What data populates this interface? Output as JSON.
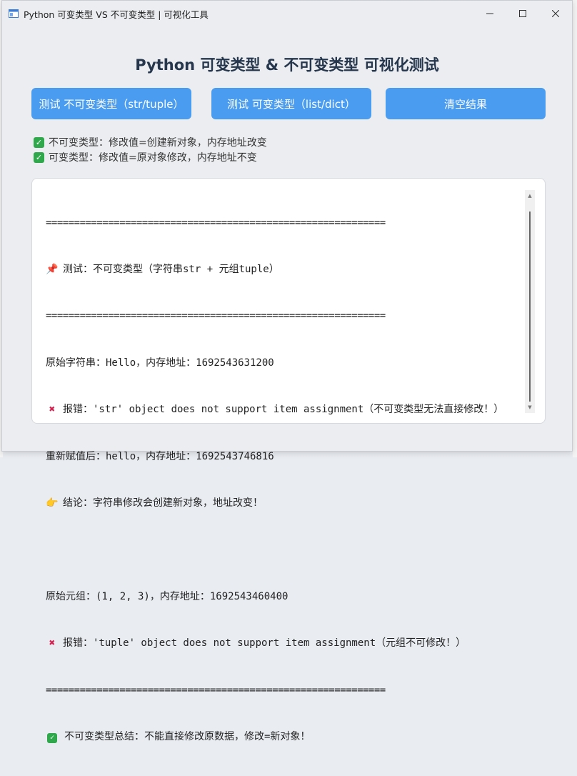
{
  "window": {
    "title": "Python 可变类型 VS 不可变类型 | 可视化工具",
    "minimize_icon": "minimize-icon",
    "maximize_icon": "maximize-icon",
    "close_icon": "close-icon"
  },
  "heading": "Python 可变类型 & 不可变类型 可视化测试",
  "buttons": {
    "test_immutable": "测试 不可变类型（str/tuple）",
    "test_mutable": "测试 可变类型（list/dict）",
    "clear": "清空结果"
  },
  "legend": {
    "immutable": "不可变类型：修改值=创建新对象，内存地址改变",
    "mutable": "可变类型：修改值=原对象修改，内存地址不变"
  },
  "log": {
    "sep": "============================================================",
    "test_title": "测试：不可变类型（字符串str + 元组tuple）",
    "line_orig_str": "原始字符串：Hello，内存地址：1692543631200",
    "line_error_str": "报错：'str' object does not support item assignment（不可变类型无法直接修改！）",
    "line_reassign": "重新赋值后：hello，内存地址：1692543746816",
    "line_conclusion": "结论：字符串修改会创建新对象，地址改变！",
    "line_orig_tuple": "原始元组：(1, 2, 3)，内存地址：1692543460400",
    "line_error_tuple": "报错：'tuple' object does not support item assignment（元组不可修改！）",
    "line_summary": "不可变类型总结：不能直接修改原数据，修改=新对象！"
  },
  "colors": {
    "button": "#4a9cf0",
    "heading": "#26374d",
    "check": "#2ea84a",
    "error": "#d6204f"
  }
}
